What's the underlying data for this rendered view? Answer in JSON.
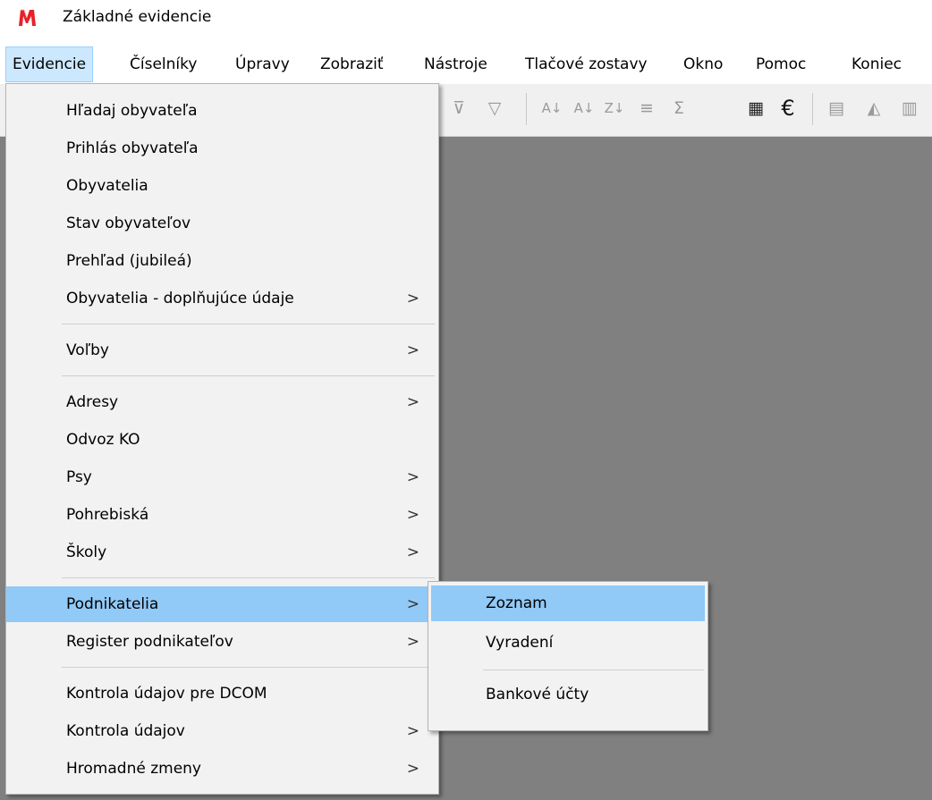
{
  "window": {
    "title": "Základné evidencie",
    "icon": "app-logo-icon"
  },
  "menubar": {
    "items": [
      {
        "label": "Evidencie"
      },
      {
        "label": "Číselníky"
      },
      {
        "label": "Úpravy"
      },
      {
        "label": "Zobraziť"
      },
      {
        "label": "Nástroje"
      },
      {
        "label": "Tlačové zostavy"
      },
      {
        "label": "Okno"
      },
      {
        "label": "Pomoc"
      },
      {
        "label": "Koniec"
      }
    ],
    "active": "Evidencie"
  },
  "toolbar": {
    "icons": [
      "filter-clear-icon",
      "filter-icon",
      "sort-az-icon",
      "sort-az-desc-icon",
      "sort-za-icon",
      "columns-icon",
      "sum-icon",
      "calculator-icon",
      "euro-icon",
      "notepad-icon",
      "shapes-icon",
      "report-icon"
    ],
    "glyphs": {
      "filter_clear": "⊽",
      "filter": "▽",
      "sort1": "A↓",
      "sort2": "A↓",
      "sort3": "Z↓",
      "columns": "≡",
      "sum": "Σ",
      "calculator": "▦",
      "euro": "€",
      "notepad": "▤",
      "shapes": "◭",
      "report": "▥"
    }
  },
  "evidencie_menu": {
    "items": [
      {
        "label": "Hľadaj obyvateľa",
        "arrow": ""
      },
      {
        "label": "Prihlás obyvateľa",
        "arrow": ""
      },
      {
        "label": "Obyvatelia",
        "arrow": ""
      },
      {
        "label": "Stav obyvateľov",
        "arrow": ""
      },
      {
        "label": "Prehľad (jubileá)",
        "arrow": ""
      },
      {
        "label": "Obyvatelia - doplňujúce údaje",
        "arrow": ">"
      },
      {
        "label": "Voľby",
        "arrow": ">"
      },
      {
        "label": "Adresy",
        "arrow": ">"
      },
      {
        "label": "Odvoz KO",
        "arrow": ""
      },
      {
        "label": "Psy",
        "arrow": ">"
      },
      {
        "label": "Pohrebiská",
        "arrow": ">"
      },
      {
        "label": "Školy",
        "arrow": ">"
      },
      {
        "label": "Podnikatelia",
        "arrow": ">"
      },
      {
        "label": "Register podnikateľov",
        "arrow": ">"
      },
      {
        "label": "Kontrola údajov pre DCOM",
        "arrow": ""
      },
      {
        "label": "Kontrola údajov",
        "arrow": ">"
      },
      {
        "label": "Hromadné zmeny",
        "arrow": ">"
      }
    ],
    "highlighted": "Podnikatelia"
  },
  "podnikatelia_submenu": {
    "items": [
      {
        "label": "Zoznam"
      },
      {
        "label": "Vyradení"
      },
      {
        "label": "Bankové účty"
      }
    ],
    "highlighted": "Zoznam"
  },
  "colors": {
    "menu_active_bg": "#cce8ff",
    "highlight_bg": "#91c9f7",
    "workspace_bg": "#808080",
    "dropdown_bg": "#f2f2f2",
    "logo_red": "#e8202a"
  }
}
